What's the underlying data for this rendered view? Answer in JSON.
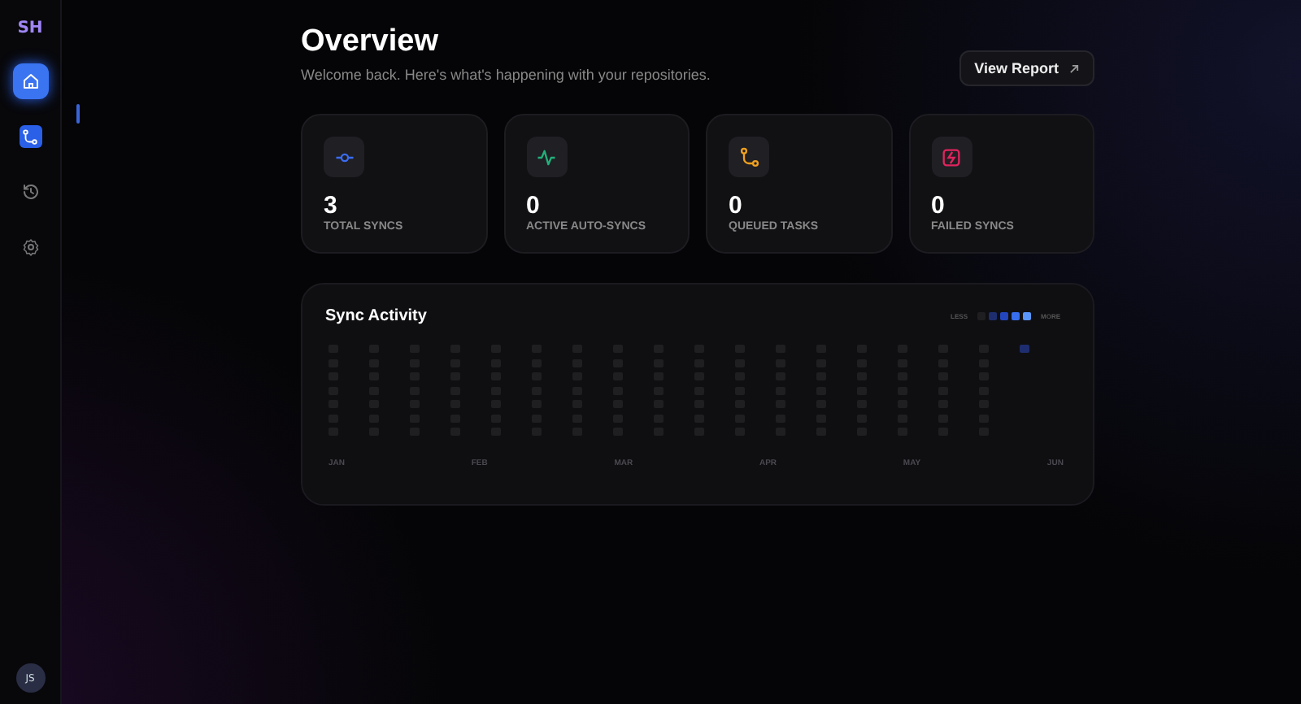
{
  "sidebar": {
    "logo": "SH",
    "items": [
      {
        "kind": "filled",
        "selected": true
      },
      {
        "kind": "accent",
        "selected": false
      },
      {
        "kind": "plain",
        "selected": false
      },
      {
        "kind": "plain",
        "selected": false
      }
    ],
    "avatar": "JS"
  },
  "header": {
    "title": "Overview",
    "subtitle": "Welcome back. Here's what's happening with your repositories.",
    "button": "View Report"
  },
  "stats": [
    {
      "color": "#3b6cf0",
      "value": "3",
      "label": "TOTAL SYNCS"
    },
    {
      "color": "#22b07a",
      "value": "0",
      "label": "ACTIVE AUTO-SYNCS"
    },
    {
      "color": "#f0a020",
      "value": "0",
      "label": "QUEUED TASKS"
    },
    {
      "color": "#e0245e",
      "value": "0",
      "label": "FAILED SYNCS"
    }
  ],
  "activity": {
    "title": "Sync Activity",
    "legend_less": "LESS",
    "legend_more": "MORE",
    "legend": [
      {
        "color": "#1f1f22"
      },
      {
        "color": "#1e2d6e"
      },
      {
        "color": "#2346be"
      },
      {
        "color": "#376eeb"
      },
      {
        "color": "#5a96fa"
      }
    ],
    "weeks": [
      {
        "days": [
          {
            "color": "#1f1f22"
          },
          {
            "color": "#1f1f22"
          },
          {
            "color": "#1f1f22"
          },
          {
            "color": "#1f1f22"
          },
          {
            "color": "#1f1f22"
          },
          {
            "color": "#1f1f22"
          },
          {
            "color": "#1f1f22"
          }
        ]
      },
      {
        "days": [
          {
            "color": "#1f1f22"
          },
          {
            "color": "#1f1f22"
          },
          {
            "color": "#1f1f22"
          },
          {
            "color": "#1f1f22"
          },
          {
            "color": "#1f1f22"
          },
          {
            "color": "#1f1f22"
          },
          {
            "color": "#1f1f22"
          }
        ]
      },
      {
        "days": [
          {
            "color": "#1f1f22"
          },
          {
            "color": "#1f1f22"
          },
          {
            "color": "#1f1f22"
          },
          {
            "color": "#1f1f22"
          },
          {
            "color": "#1f1f22"
          },
          {
            "color": "#1f1f22"
          },
          {
            "color": "#1f1f22"
          }
        ]
      },
      {
        "days": [
          {
            "color": "#1f1f22"
          },
          {
            "color": "#1f1f22"
          },
          {
            "color": "#1f1f22"
          },
          {
            "color": "#1f1f22"
          },
          {
            "color": "#1f1f22"
          },
          {
            "color": "#1f1f22"
          },
          {
            "color": "#1f1f22"
          }
        ]
      },
      {
        "days": [
          {
            "color": "#1f1f22"
          },
          {
            "color": "#1f1f22"
          },
          {
            "color": "#1f1f22"
          },
          {
            "color": "#1f1f22"
          },
          {
            "color": "#1f1f22"
          },
          {
            "color": "#1f1f22"
          },
          {
            "color": "#1f1f22"
          }
        ]
      },
      {
        "days": [
          {
            "color": "#1f1f22"
          },
          {
            "color": "#1f1f22"
          },
          {
            "color": "#1f1f22"
          },
          {
            "color": "#1f1f22"
          },
          {
            "color": "#1f1f22"
          },
          {
            "color": "#1f1f22"
          },
          {
            "color": "#1f1f22"
          }
        ]
      },
      {
        "days": [
          {
            "color": "#1f1f22"
          },
          {
            "color": "#1f1f22"
          },
          {
            "color": "#1f1f22"
          },
          {
            "color": "#1f1f22"
          },
          {
            "color": "#1f1f22"
          },
          {
            "color": "#1f1f22"
          },
          {
            "color": "#1f1f22"
          }
        ]
      },
      {
        "days": [
          {
            "color": "#1f1f22"
          },
          {
            "color": "#1f1f22"
          },
          {
            "color": "#1f1f22"
          },
          {
            "color": "#1f1f22"
          },
          {
            "color": "#1f1f22"
          },
          {
            "color": "#1f1f22"
          },
          {
            "color": "#1f1f22"
          }
        ]
      },
      {
        "days": [
          {
            "color": "#1f1f22"
          },
          {
            "color": "#1f1f22"
          },
          {
            "color": "#1f1f22"
          },
          {
            "color": "#1f1f22"
          },
          {
            "color": "#1f1f22"
          },
          {
            "color": "#1f1f22"
          },
          {
            "color": "#1f1f22"
          }
        ]
      },
      {
        "days": [
          {
            "color": "#1f1f22"
          },
          {
            "color": "#1f1f22"
          },
          {
            "color": "#1f1f22"
          },
          {
            "color": "#1f1f22"
          },
          {
            "color": "#1f1f22"
          },
          {
            "color": "#1f1f22"
          },
          {
            "color": "#1f1f22"
          }
        ]
      },
      {
        "days": [
          {
            "color": "#1f1f22"
          },
          {
            "color": "#1f1f22"
          },
          {
            "color": "#1f1f22"
          },
          {
            "color": "#1f1f22"
          },
          {
            "color": "#1f1f22"
          },
          {
            "color": "#1f1f22"
          },
          {
            "color": "#1f1f22"
          }
        ]
      },
      {
        "days": [
          {
            "color": "#1f1f22"
          },
          {
            "color": "#1f1f22"
          },
          {
            "color": "#1f1f22"
          },
          {
            "color": "#1f1f22"
          },
          {
            "color": "#1f1f22"
          },
          {
            "color": "#1f1f22"
          },
          {
            "color": "#1f1f22"
          }
        ]
      },
      {
        "days": [
          {
            "color": "#1f1f22"
          },
          {
            "color": "#1f1f22"
          },
          {
            "color": "#1f1f22"
          },
          {
            "color": "#1f1f22"
          },
          {
            "color": "#1f1f22"
          },
          {
            "color": "#1f1f22"
          },
          {
            "color": "#1f1f22"
          }
        ]
      },
      {
        "days": [
          {
            "color": "#1f1f22"
          },
          {
            "color": "#1f1f22"
          },
          {
            "color": "#1f1f22"
          },
          {
            "color": "#1f1f22"
          },
          {
            "color": "#1f1f22"
          },
          {
            "color": "#1f1f22"
          },
          {
            "color": "#1f1f22"
          }
        ]
      },
      {
        "days": [
          {
            "color": "#1f1f22"
          },
          {
            "color": "#1f1f22"
          },
          {
            "color": "#1f1f22"
          },
          {
            "color": "#1f1f22"
          },
          {
            "color": "#1f1f22"
          },
          {
            "color": "#1f1f22"
          },
          {
            "color": "#1f1f22"
          }
        ]
      },
      {
        "days": [
          {
            "color": "#1f1f22"
          },
          {
            "color": "#1f1f22"
          },
          {
            "color": "#1f1f22"
          },
          {
            "color": "#1f1f22"
          },
          {
            "color": "#1f1f22"
          },
          {
            "color": "#1f1f22"
          },
          {
            "color": "#1f1f22"
          }
        ]
      },
      {
        "days": [
          {
            "color": "#1f1f22"
          },
          {
            "color": "#1f1f22"
          },
          {
            "color": "#1f1f22"
          },
          {
            "color": "#1f1f22"
          },
          {
            "color": "#1f1f22"
          },
          {
            "color": "#1f1f22"
          },
          {
            "color": "#1f1f22"
          }
        ]
      },
      {
        "days": [
          {
            "color": "#1e2d6e"
          }
        ]
      }
    ],
    "months": [
      "JAN",
      "FEB",
      "MAR",
      "APR",
      "MAY",
      "JUN"
    ]
  }
}
